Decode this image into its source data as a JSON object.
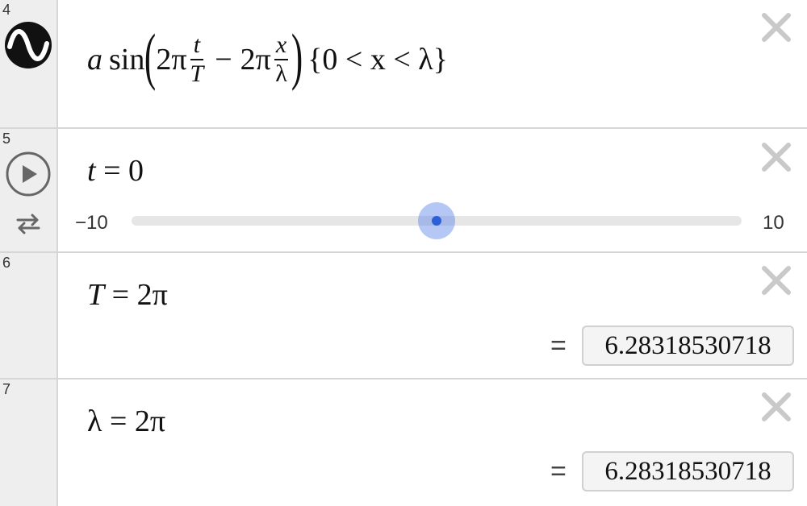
{
  "rows": [
    {
      "number": "4",
      "expression": {
        "a": "a",
        "sin": "sin",
        "two_pi_1": "2π",
        "t_num": "t",
        "T_den": "T",
        "minus": "−",
        "two_pi_2": "2π",
        "x_num": "x",
        "lambda_den": "λ",
        "restriction": "{0 < x < λ}"
      },
      "icon": "sine-wave-icon"
    },
    {
      "number": "5",
      "lhs": "t",
      "eq": "= 0",
      "slider": {
        "min_label": "−10",
        "max_label": "10",
        "value": 0,
        "min": -10,
        "max": 10
      },
      "play_icon": "play-icon",
      "loop_icon": "loop-icon"
    },
    {
      "number": "6",
      "lhs": "T",
      "rhs": "= 2π",
      "result_eq": "=",
      "result": "6.28318530718"
    },
    {
      "number": "7",
      "lhs": "λ",
      "rhs": "= 2π",
      "result_eq": "=",
      "result": "6.28318530718"
    }
  ],
  "colors": {
    "gutter": "#eeeeee",
    "border": "#d6d6d6",
    "slider_thumb": "#2c5fd8",
    "close_icon": "#c9c9c9"
  }
}
